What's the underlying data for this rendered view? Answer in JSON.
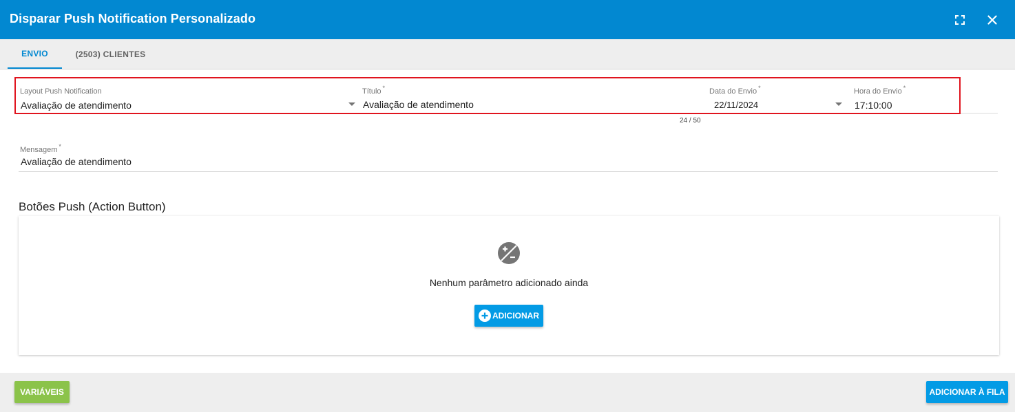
{
  "dialog": {
    "title": "Disparar Push Notification Personalizado",
    "fullscreen_icon": "fullscreen-icon",
    "close_icon": "close-icon"
  },
  "tabs": [
    {
      "label": "ENVIO",
      "active": true
    },
    {
      "label": "(2503) CLIENTES",
      "active": false
    }
  ],
  "form": {
    "layout": {
      "label": "Layout Push Notification",
      "value": "Avaliação de atendimento"
    },
    "titulo": {
      "label": "Título",
      "required": "*",
      "value": "Avaliação de atendimento",
      "counter": "24 / 50"
    },
    "data_envio": {
      "label": "Data do Envio",
      "required": "*",
      "value": "22/11/2024"
    },
    "hora_envio": {
      "label": "Hora do Envio",
      "required": "*",
      "value": "17:10:00"
    },
    "mensagem": {
      "label": "Mensagem",
      "required": "*",
      "value": "Avaliação de atendimento"
    }
  },
  "action_buttons": {
    "section_title": "Botões Push (Action Button)",
    "empty_icon": "plus-minus-circle-icon",
    "empty_text": "Nenhum parâmetro adicionado ainda",
    "add_label": "ADICIONAR",
    "add_icon": "add-circle-icon"
  },
  "footer": {
    "variables_label": "VARIÁVEIS",
    "queue_label": "ADICIONAR À FILA"
  },
  "colors": {
    "primary": "#0288d1",
    "button_blue": "#039be5",
    "button_green": "#8bc34a",
    "highlight_red": "#e0141e"
  }
}
